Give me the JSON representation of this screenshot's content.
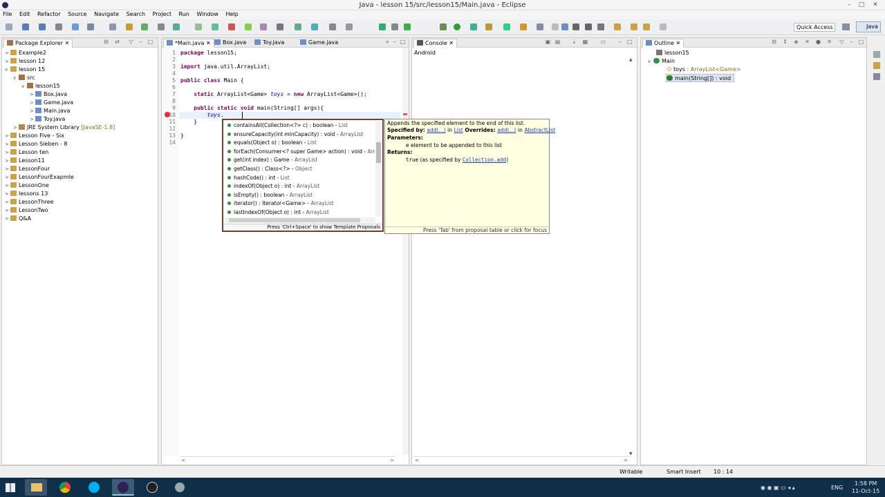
{
  "window": {
    "title": "Java - lesson 15/src/lesson15/Main.java - Eclipse"
  },
  "menu": [
    "File",
    "Edit",
    "Refactor",
    "Source",
    "Navigate",
    "Search",
    "Project",
    "Run",
    "Window",
    "Help"
  ],
  "quick_access": "Quick Access",
  "package_explorer": {
    "tab": "Package Explorer",
    "items": [
      {
        "label": "Example2",
        "indent": 0,
        "twisty": ">",
        "icon": "proj"
      },
      {
        "label": "lesson 12",
        "indent": 0,
        "twisty": ">",
        "icon": "proj"
      },
      {
        "label": "lesson 15",
        "indent": 0,
        "twisty": "v",
        "icon": "proj"
      },
      {
        "label": "src",
        "indent": 1,
        "twisty": "v",
        "icon": "pkg"
      },
      {
        "label": "lesson15",
        "indent": 2,
        "twisty": "v",
        "icon": "pkg"
      },
      {
        "label": "Box.java",
        "indent": 3,
        "twisty": ">",
        "icon": "jf"
      },
      {
        "label": "Game.java",
        "indent": 3,
        "twisty": ">",
        "icon": "jf"
      },
      {
        "label": "Main.java",
        "indent": 3,
        "twisty": ">",
        "icon": "jf"
      },
      {
        "label": "Toy.java",
        "indent": 3,
        "twisty": ">",
        "icon": "jf"
      },
      {
        "label": "JRE System Library",
        "suffix": "[JavaSE-1.8]",
        "indent": 1,
        "twisty": ">",
        "icon": "lib"
      },
      {
        "label": "Lesson Five - Six",
        "indent": 0,
        "twisty": ">",
        "icon": "proj"
      },
      {
        "label": "Lesson Sieben - 8",
        "indent": 0,
        "twisty": ">",
        "icon": "proj"
      },
      {
        "label": "Lesson ten",
        "indent": 0,
        "twisty": ">",
        "icon": "proj"
      },
      {
        "label": "Lesson11",
        "indent": 0,
        "twisty": ">",
        "icon": "proj"
      },
      {
        "label": "LessonFour",
        "indent": 0,
        "twisty": ">",
        "icon": "proj"
      },
      {
        "label": "LessonFourExapmle",
        "indent": 0,
        "twisty": ">",
        "icon": "proj"
      },
      {
        "label": "LessonOne",
        "indent": 0,
        "twisty": ">",
        "icon": "proj"
      },
      {
        "label": "lessons 13",
        "indent": 0,
        "twisty": ">",
        "icon": "proj"
      },
      {
        "label": "LessonThree",
        "indent": 0,
        "twisty": ">",
        "icon": "proj"
      },
      {
        "label": "LessonTwo",
        "indent": 0,
        "twisty": ">",
        "icon": "proj"
      },
      {
        "label": "Q&A",
        "indent": 0,
        "twisty": ">",
        "icon": "proj"
      }
    ]
  },
  "editor": {
    "tabs": [
      "*Main.java",
      "Box.java",
      "Toy.java",
      "Game.java"
    ],
    "line_numbers": [
      "1",
      "2",
      "3",
      "4",
      "5",
      "6",
      "7",
      "8",
      "9",
      "10",
      "11",
      "12",
      "13",
      "14"
    ],
    "lines": [
      [
        {
          "t": "package ",
          "k": "kw"
        },
        {
          "t": "lesson15;"
        }
      ],
      [],
      [
        {
          "t": "import ",
          "k": "kw"
        },
        {
          "t": "java.util.ArrayList;"
        }
      ],
      [],
      [
        {
          "t": "public class ",
          "k": "kw"
        },
        {
          "t": "Main {"
        }
      ],
      [],
      [
        {
          "t": "    "
        },
        {
          "t": "static ",
          "k": "kw"
        },
        {
          "t": "ArrayList<Game> "
        },
        {
          "t": "toys",
          "k": "it"
        },
        {
          "t": " = "
        },
        {
          "t": "new ",
          "k": "kw"
        },
        {
          "t": "ArrayList<Game>();"
        }
      ],
      [],
      [
        {
          "t": "    "
        },
        {
          "t": "public static void ",
          "k": "kw"
        },
        {
          "t": "main(String[] args){"
        }
      ],
      [
        {
          "t": "        "
        },
        {
          "t": "toys",
          "k": "it"
        },
        {
          "t": "."
        }
      ],
      [
        {
          "t": "    }"
        }
      ],
      [],
      [
        {
          "t": "}"
        }
      ],
      []
    ]
  },
  "proposals": {
    "items": [
      {
        "sig": "containsAll(Collection<?> c) : boolean",
        "type": "List"
      },
      {
        "sig": "ensureCapacity(int minCapacity) : void",
        "type": "ArrayList"
      },
      {
        "sig": "equals(Object o) : boolean",
        "type": "List"
      },
      {
        "sig": "forEach(Consumer<? super Game> action) : void",
        "type": "ArrayList"
      },
      {
        "sig": "get(int index) : Game",
        "type": "ArrayList"
      },
      {
        "sig": "getClass() : Class<?>",
        "type": "Object"
      },
      {
        "sig": "hashCode() : int",
        "type": "List"
      },
      {
        "sig": "indexOf(Object o) : int",
        "type": "ArrayList"
      },
      {
        "sig": "isEmpty() : boolean",
        "type": "ArrayList"
      },
      {
        "sig": "iterator() : Iterator<Game>",
        "type": "ArrayList"
      },
      {
        "sig": "lastIndexOf(Object o) : int",
        "type": "ArrayList"
      }
    ],
    "footer": "Press 'Ctrl+Space' to show Template Proposals"
  },
  "doc": {
    "summary": "Appends the specified element to the end of this list.",
    "specified_by": "Specified by:",
    "add1": "add(...)",
    "in": "in",
    "list": "List",
    "overrides": "Overrides:",
    "add2": "add(...)",
    "abstractlist": "AbstractList",
    "parameters": "Parameters:",
    "param_e": "e",
    "param_desc": "element to be appended to this list",
    "returns": "Returns:",
    "ret_true": "true",
    "ret_mid": "(as specified by",
    "ret_link": "Collection.add",
    "ret_end": ")",
    "footer": "Press 'Tab' from proposal table or click for focus"
  },
  "console": {
    "tab": "Console",
    "text": "Android"
  },
  "outline": {
    "tab": "Outline",
    "package": "lesson15",
    "class": "Main",
    "field_name": "toys",
    "field_type": ": ArrayList<Game>",
    "method": "main(String[]) : void"
  },
  "status": {
    "writable": "Writable",
    "insert": "Smart Insert",
    "position": "10 : 14"
  },
  "taskbar": {
    "lang": "ENG",
    "time": "1:58 PM",
    "date": "11-Oct-15"
  },
  "colors": {
    "kw": "#7f0055",
    "field": "#0000c0",
    "taskbar": "#10304a"
  }
}
